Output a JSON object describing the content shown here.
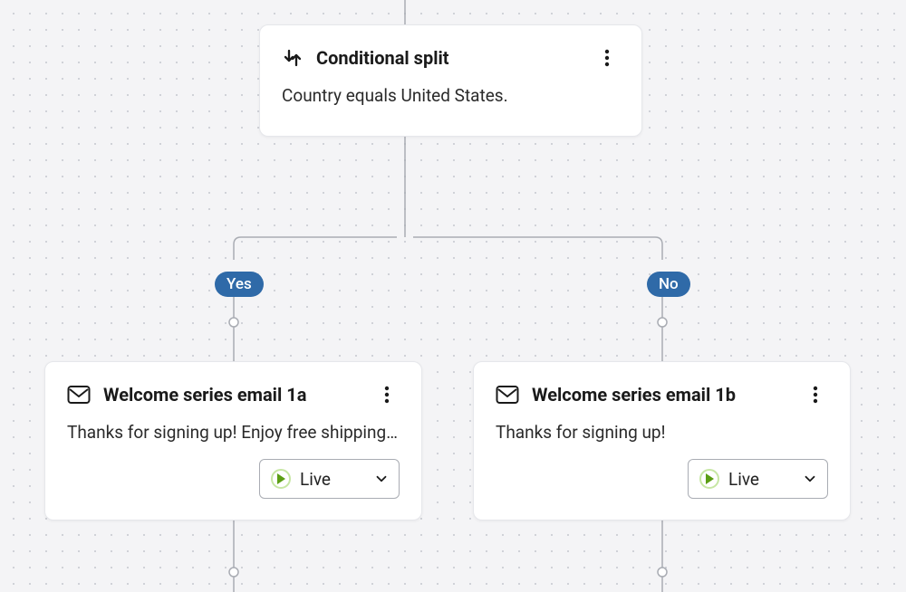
{
  "conditional": {
    "title": "Conditional split",
    "description": "Country equals United States."
  },
  "branches": {
    "yes_label": "Yes",
    "no_label": "No"
  },
  "email_left": {
    "title": "Welcome series email 1a",
    "description": "Thanks for signing up! Enjoy free shipping...",
    "status_label": "Live"
  },
  "email_right": {
    "title": "Welcome series email 1b",
    "description": "Thanks for signing up!",
    "status_label": "Live"
  }
}
